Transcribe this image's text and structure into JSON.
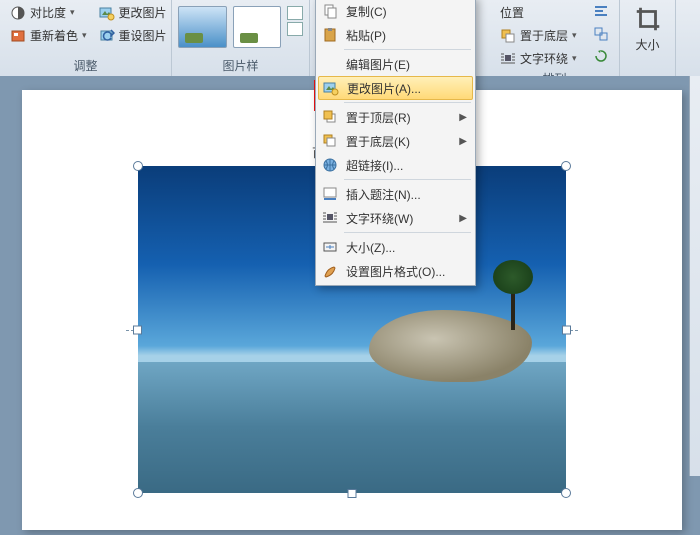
{
  "ribbon": {
    "adjust": {
      "contrast": "对比度",
      "recolor": "重新着色",
      "change_pic": "更改图片",
      "reset_pic": "重设图片",
      "title": "调整"
    },
    "styles": {
      "title": "图片样"
    },
    "arrange": {
      "position": "位置",
      "send_back": "置于底层",
      "text_wrap": "文字环绕",
      "title": "排列"
    },
    "size": {
      "title": "大小"
    }
  },
  "doc_text": "百",
  "context_menu": {
    "copy": "复制(C)",
    "paste": "粘贴(P)",
    "edit_pic": "编辑图片(E)",
    "change_pic": "更改图片(A)...",
    "bring_front": "置于顶层(R)",
    "send_back": "置于底层(K)",
    "hyperlink": "超链接(I)...",
    "caption": "插入题注(N)...",
    "text_wrap": "文字环绕(W)",
    "size": "大小(Z)...",
    "format_pic": "设置图片格式(O)..."
  }
}
